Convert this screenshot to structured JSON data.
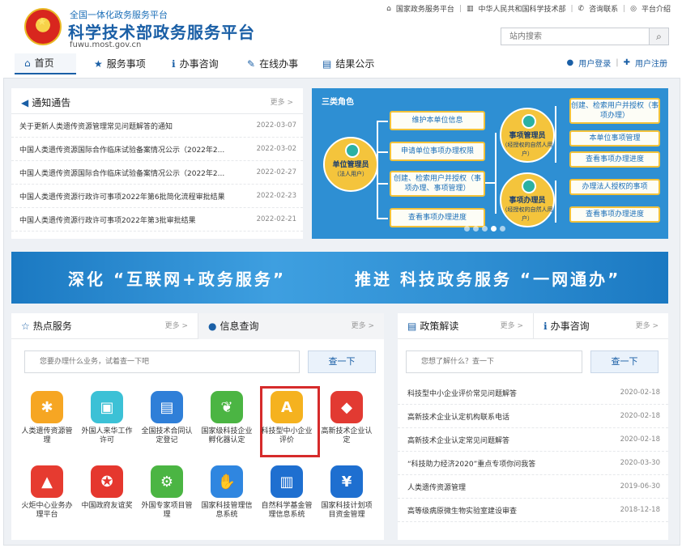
{
  "header": {
    "subtitle": "全国一体化政务服务平台",
    "title": "科学技术部政务服务平台",
    "domain": "fuwu.most.gov.cn",
    "toplinks": [
      "国家政务服务平台",
      "中华人民共和国科学技术部",
      "咨询联系",
      "平台介绍"
    ],
    "search_placeholder": "站内搜索"
  },
  "nav": {
    "items": [
      "首页",
      "服务事项",
      "办事咨询",
      "在线办事",
      "结果公示"
    ],
    "login": "用户登录",
    "register": "用户注册"
  },
  "notice": {
    "title": "通知通告",
    "more": "更多 >",
    "items": [
      {
        "text": "关于更新人类遗传资源管理常见问题解答的通知",
        "date": "2022-03-07"
      },
      {
        "text": "中国人类遗传资源国际合作临床试验备案情况公示（2022年2...",
        "date": "2022-03-02"
      },
      {
        "text": "中国人类遗传资源国际合作临床试验备案情况公示（2022年2...",
        "date": "2022-02-27"
      },
      {
        "text": "中国人类遗传资源行政许可事项2022年第6批简化流程审批结果",
        "date": "2022-02-23"
      },
      {
        "text": "中国人类遗传资源行政许可事项2022年第3批审批结果",
        "date": "2022-02-21"
      }
    ]
  },
  "diagram": {
    "header": "三类角色",
    "roles": [
      {
        "name": "单位管理员",
        "sub": "（法人用户）"
      },
      {
        "name": "事项管理员",
        "sub": "（经授权的自然人用户）"
      },
      {
        "name": "事项办理员",
        "sub": "（经授权的自然人用户）"
      }
    ],
    "left_boxes": [
      "维护本单位信息",
      "申请单位事项办理权限",
      "创建、检索用户并授权（事项办理、事项管理）",
      "查看事项办理进度"
    ],
    "right_boxes": [
      "创建、检索用户并授权（事项办理）",
      "本单位事项管理",
      "查看事项办理进度",
      "办理法人授权的事项",
      "查看事项办理进度"
    ]
  },
  "banner": {
    "left": "深化 “互联网+政务服务”",
    "right": "推进 科技政务服务 “一网通办”"
  },
  "hot": {
    "tab1": "热点服务",
    "tab2": "信息查询",
    "more": "更多 >",
    "search_placeholder": "您要办理什么业务，试着查一下吧",
    "search_button": "查一下",
    "services": [
      {
        "label": "人类遗传资源管理",
        "color": "#f6a623",
        "icon": "dna-icon",
        "glyph": "✱"
      },
      {
        "label": "外国人来华工作许可",
        "color": "#3cc1d6",
        "icon": "id-card-icon",
        "glyph": "▣"
      },
      {
        "label": "全国技术合同认定登记",
        "color": "#2f7fd8",
        "icon": "contract-icon",
        "glyph": "▤"
      },
      {
        "label": "国家级科技企业孵化器认定",
        "color": "#4bb543",
        "icon": "sprout-icon",
        "glyph": "❦"
      },
      {
        "label": "科技型中小企业评价",
        "color": "#f5b21f",
        "icon": "grade-a-icon",
        "glyph": "A"
      },
      {
        "label": "高新技术企业认定",
        "color": "#e23a32",
        "icon": "flame-icon",
        "glyph": "◆"
      },
      {
        "label": "火炬中心业务办理平台",
        "color": "#e63b30",
        "icon": "torch-icon",
        "glyph": "▲"
      },
      {
        "label": "中国政府友谊奖",
        "color": "#e5372e",
        "icon": "medal-icon",
        "glyph": "✪"
      },
      {
        "label": "外国专家项目管理",
        "color": "#4bb543",
        "icon": "project-icon",
        "glyph": "⚙"
      },
      {
        "label": "国家科技管理信息系统",
        "color": "#2f86e0",
        "icon": "handshake-icon",
        "glyph": "✋"
      },
      {
        "label": "自然科学基金管理信息系统",
        "color": "#1e6fd0",
        "icon": "fund-icon",
        "glyph": "▥"
      },
      {
        "label": "国家科技计划项目资金管理",
        "color": "#1e6fd0",
        "icon": "yuan-icon",
        "glyph": "¥"
      }
    ]
  },
  "policy": {
    "tab1": "政策解读",
    "tab2": "办事咨询",
    "more": "更多 >",
    "search_placeholder": "您想了解什么？查一下",
    "search_button": "查一下",
    "items": [
      {
        "text": "科技型中小企业评价常见问题解答",
        "date": "2020-02-18"
      },
      {
        "text": "高新技术企业认定机构联系电话",
        "date": "2020-02-18"
      },
      {
        "text": "高新技术企业认定常见问题解答",
        "date": "2020-02-18"
      },
      {
        "text": "“科技助力经济2020”重点专项你问我答",
        "date": "2020-03-30"
      },
      {
        "text": "人类遗传资源管理",
        "date": "2019-06-30"
      },
      {
        "text": "高等级病原微生物实验室建设审查",
        "date": "2018-12-18"
      }
    ]
  }
}
